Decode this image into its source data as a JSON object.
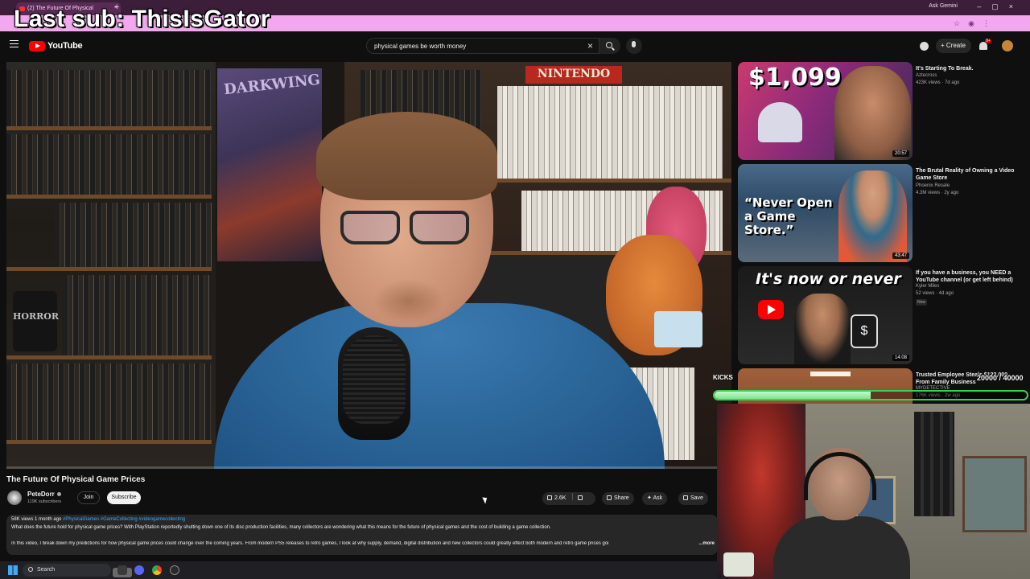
{
  "browser": {
    "tab_title": "(2) The Future Of Physical",
    "ask_gemini": "Ask Gemini",
    "stream_banner": "Last sub: ThisIsGator"
  },
  "header": {
    "logo_text": "YouTube",
    "search_value": "physical games be worth money",
    "create_label": "+ Create",
    "notification_count": "9+"
  },
  "video": {
    "title": "The Future Of Physical Game Prices",
    "poster_text": "DARKWING",
    "nintendo_text": "NINTENDO",
    "mug_text": "HORROR",
    "progress": 0.0
  },
  "channel": {
    "name": "PeteDorr",
    "subscribers": "119K subscribers",
    "join_label": "Join",
    "subscribe_label": "Subscribe"
  },
  "actions": {
    "likes": "2.6K",
    "share_label": "Share",
    "ask_label": "Ask",
    "save_label": "Save"
  },
  "description": {
    "views_date": "58K views  1 month ago",
    "tags": "#PhysicalGames #GameCollecting #videogamecollecting",
    "line1": "What does the future hold for physical game prices? With PlayStation reportedly shutting down one of its disc production facilities, many collectors are wondering what this means for the future of physical games and the cost of building a game collection.",
    "line2": "In this video, I break down my predictions for how physical game prices could change over the coming years. From modern PS5 releases to retro games, I look at why supply, demand, digital distribution and new collectors could greatly effect both modern and retro game prices goi",
    "more_label": "...more"
  },
  "recommendations": [
    {
      "title": "It's Starting To Break.",
      "channel": "Aztecross",
      "meta": "423K views · 7d ago",
      "duration": "20:57",
      "thumb_text": "$1,099",
      "badge": ""
    },
    {
      "title": "The Brutal Reality of Owning a Video Game Store",
      "channel": "Phoenix Resale",
      "meta": "4.3M views · 2y ago",
      "duration": "43:47",
      "thumb_text": "“Never Open a Game Store.”",
      "badge": ""
    },
    {
      "title": "If you have a business, you NEED a YouTube channel (or get left behind)",
      "channel": "Kyler Miles",
      "meta": "52 views · 4d ago",
      "duration": "14:08",
      "thumb_text": "It's now or never",
      "badge": "New"
    },
    {
      "title": "Trusted Employee Steals $122,000 From Family Business",
      "channel": "MYDETECTIVE",
      "meta": "176K views · 2w ago",
      "duration": "",
      "thumb_text": "",
      "badge": ""
    }
  ],
  "sub_goal": {
    "label": "KICKS",
    "count": "20000 / 40000",
    "fraction": 0.5
  },
  "taskbar": {
    "search_label": "Search"
  },
  "colors": {
    "youtube_red": "#ff0000",
    "banner_pink": "#f2a7ee",
    "goal_green": "#39d353"
  }
}
